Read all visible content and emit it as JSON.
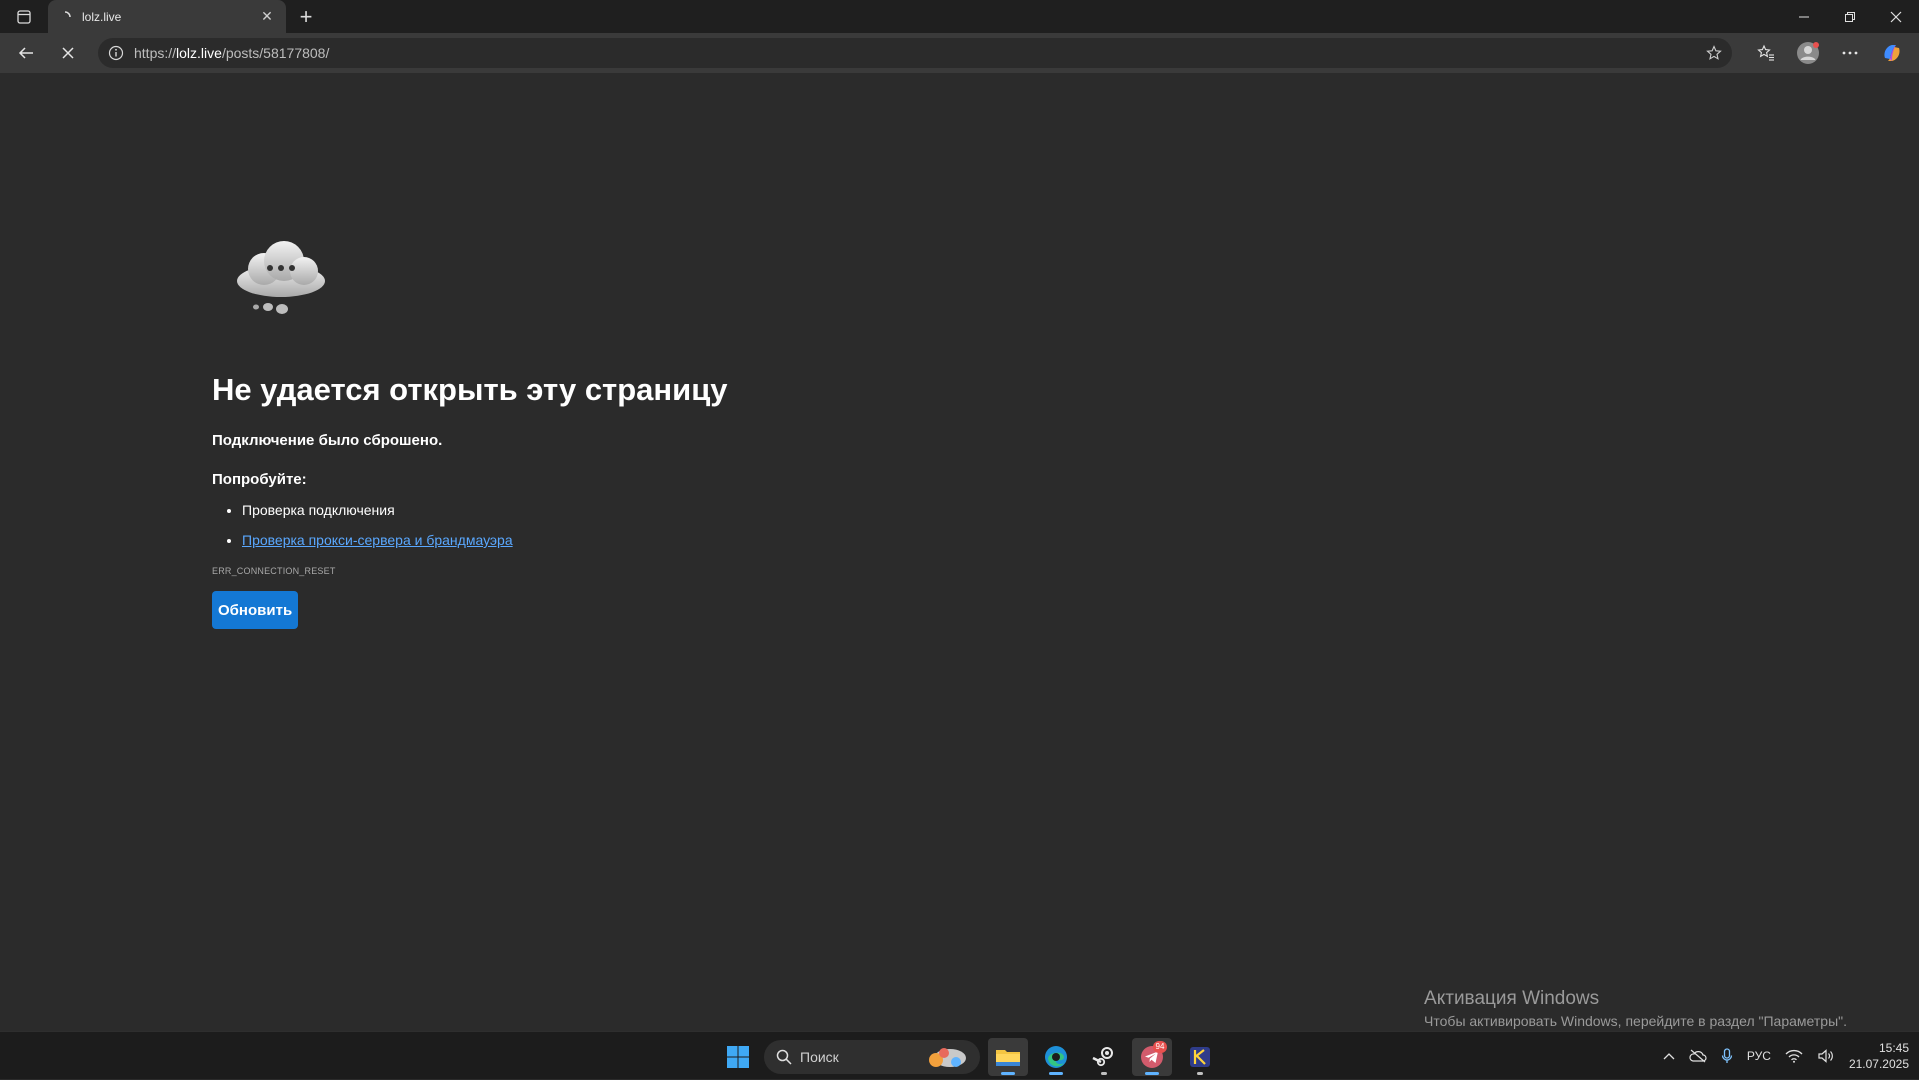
{
  "browser": {
    "tab_title": "lolz.live",
    "tab_close": "✕",
    "new_tab": "+",
    "url_prefix": "https://",
    "url_domain": "lolz.live",
    "url_path": "/posts/58177808/"
  },
  "error_page": {
    "title": "Не удается открыть эту страницу",
    "subtitle": "Подключение было сброшено.",
    "try_label": "Попробуйте:",
    "suggestions": [
      "Проверка подключения",
      "Проверка прокси-сервера и брандмауэра"
    ],
    "error_code": "ERR_CONNECTION_RESET",
    "reload_label": "Обновить"
  },
  "watermark": {
    "title": "Активация Windows",
    "text": "Чтобы активировать Windows, перейдите в раздел \"Параметры\"."
  },
  "taskbar": {
    "search_placeholder": "Поиск",
    "telegram_badge": "94",
    "language": "РУС",
    "time": "15:45",
    "date": "21.07.2025"
  },
  "colors": {
    "background": "#2b2b2b",
    "link": "#5aa8ff",
    "button": "#1478d4"
  }
}
